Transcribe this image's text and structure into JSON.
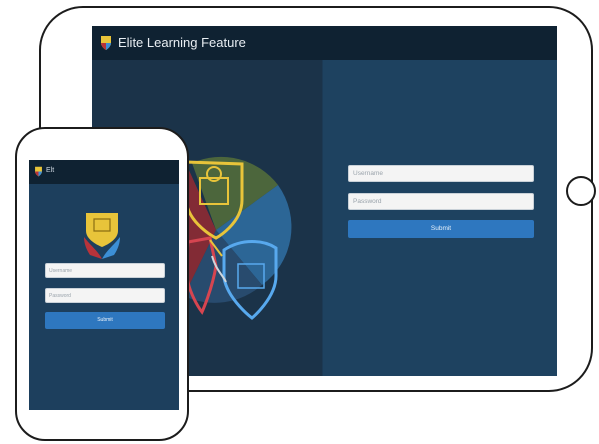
{
  "tablet": {
    "app_title": "Elite Learning Feature",
    "username_placeholder": "Username",
    "password_placeholder": "Password",
    "submit_label": "Submit"
  },
  "phone": {
    "app_title": "Elt",
    "username_placeholder": "Username",
    "password_placeholder": "Password",
    "submit_label": "Submit"
  },
  "colors": {
    "header": "#0f2232",
    "panel_left": "#1b3349",
    "panel_right": "#1e4260",
    "submit": "#2e77bf",
    "emblem_gold": "#e8c43a",
    "emblem_red": "#b8333a",
    "emblem_blue": "#3c8fd6",
    "emblem_green": "#6a8e3c"
  },
  "icons": [
    "logo-icon",
    "home-button-icon",
    "crest-emblem-icon"
  ]
}
